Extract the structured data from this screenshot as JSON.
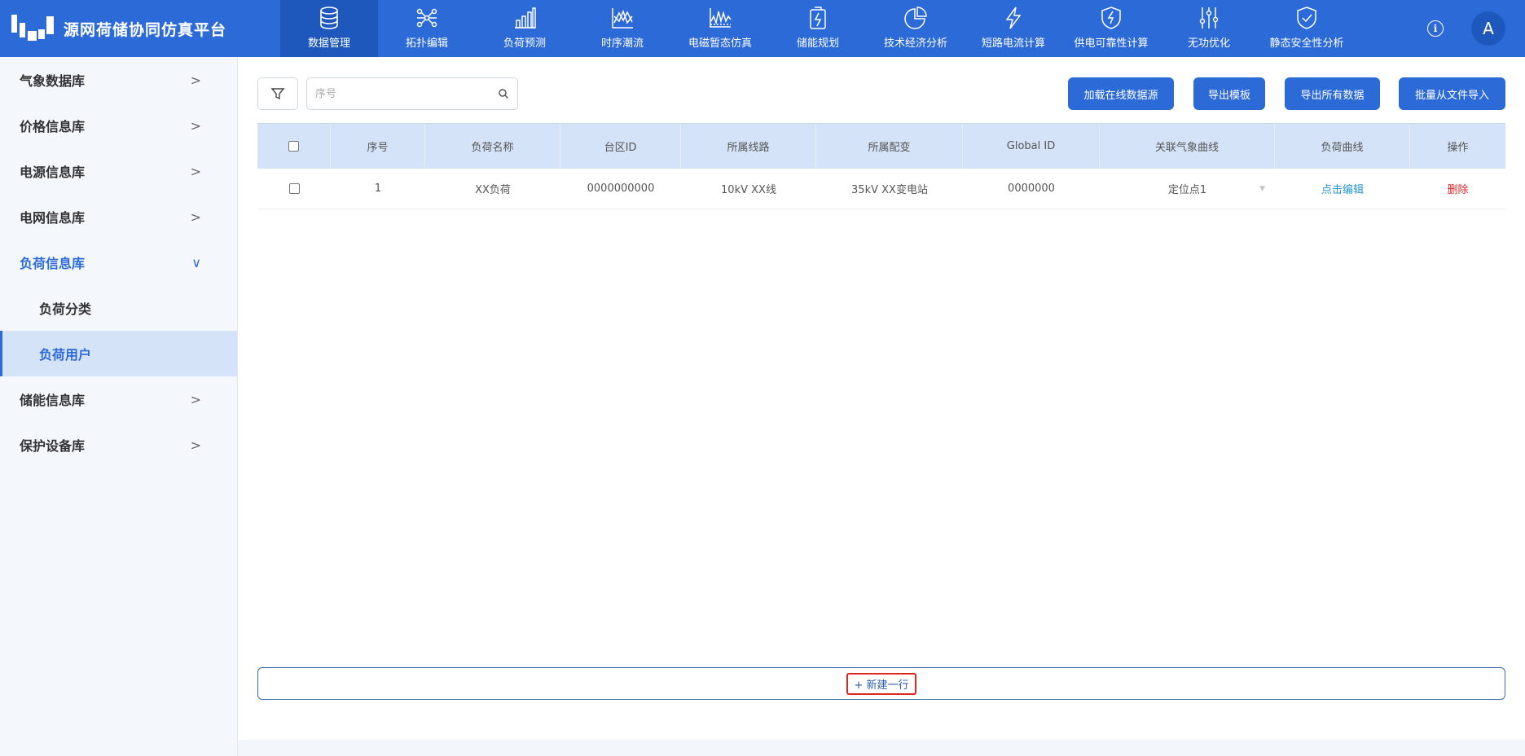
{
  "app": {
    "title": "源网荷储协同仿真平台"
  },
  "nav": [
    {
      "label": "数据管理",
      "icon": "database-icon",
      "active": true
    },
    {
      "label": "拓扑编辑",
      "icon": "topology-icon"
    },
    {
      "label": "负荷预测",
      "icon": "bar-chart-icon"
    },
    {
      "label": "时序潮流",
      "icon": "line-chart-icon"
    },
    {
      "label": "电磁暂态仿真",
      "icon": "waveform-icon"
    },
    {
      "label": "储能规划",
      "icon": "battery-icon"
    },
    {
      "label": "技术经济分析",
      "icon": "pie-chart-icon"
    },
    {
      "label": "短路电流计算",
      "icon": "lightning-icon"
    },
    {
      "label": "供电可靠性计算",
      "icon": "shield-bolt-icon"
    },
    {
      "label": "无功优化",
      "icon": "sliders-icon"
    },
    {
      "label": "静态安全性分析",
      "icon": "shield-check-icon"
    }
  ],
  "user": {
    "avatar": "A",
    "info": "i"
  },
  "sidebar": {
    "items": [
      {
        "label": "气象数据库"
      },
      {
        "label": "价格信息库"
      },
      {
        "label": "电源信息库"
      },
      {
        "label": "电网信息库"
      },
      {
        "label": "负荷信息库",
        "open": true
      },
      {
        "label": "储能信息库"
      },
      {
        "label": "保护设备库"
      }
    ],
    "sub_items": [
      {
        "label": "负荷分类"
      },
      {
        "label": "负荷用户",
        "active": true
      }
    ],
    "chevron_closed": ">",
    "chevron_open": "∨"
  },
  "search": {
    "placeholder": "序号"
  },
  "toolbar": {
    "load_online": "加载在线数据源",
    "export_template": "导出模板",
    "export_all": "导出所有数据",
    "batch_import": "批量从文件导入"
  },
  "table": {
    "columns": [
      "序号",
      "负荷名称",
      "台区ID",
      "所属线路",
      "所属配变",
      "Global ID",
      "关联气象曲线",
      "负荷曲线",
      "操作"
    ],
    "rows": [
      {
        "index": "1",
        "name": "XX负荷",
        "area_id": "0000000000",
        "line": "10kV XX线",
        "transformer": "35kV XX变电站",
        "global_id": "0000000",
        "weather_curve": "定位点1",
        "load_curve": "点击编辑",
        "action": "删除"
      }
    ]
  },
  "add_row": {
    "label": "+ 新建一行"
  }
}
